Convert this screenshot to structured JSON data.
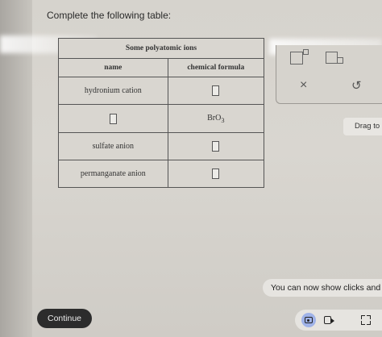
{
  "prompt": "Complete the following table:",
  "table": {
    "title": "Some polyatomic ions",
    "headers": {
      "name": "name",
      "formula": "chemical formula"
    },
    "rows": [
      {
        "name": "hydronium cation",
        "formula": ""
      },
      {
        "name": "",
        "formula": "BrO",
        "formula_sub": "3"
      },
      {
        "name": "sulfate anion",
        "formula": ""
      },
      {
        "name": "permanganate anion",
        "formula": ""
      }
    ]
  },
  "tools": {
    "clear": "×",
    "undo": "↺"
  },
  "drag_hint": "Drag to",
  "notice": "You can now show clicks and",
  "continue_label": "Continue",
  "icons": [
    "superscript-icon",
    "subscript-icon",
    "close-icon",
    "undo-icon",
    "camera-icon",
    "video-icon",
    "fullscreen-icon"
  ]
}
